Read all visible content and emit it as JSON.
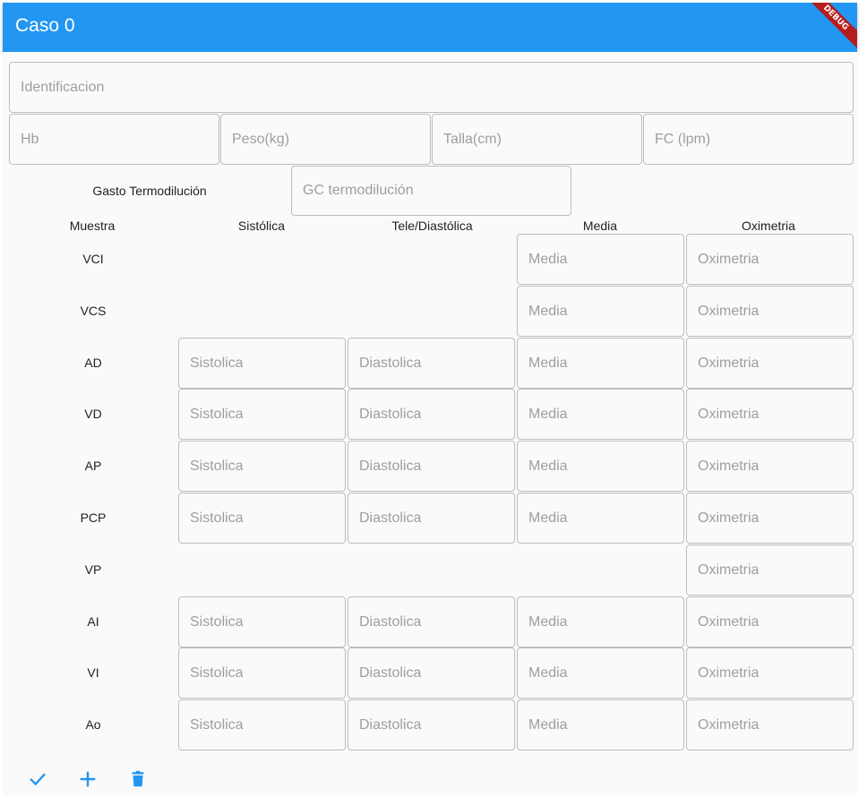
{
  "appbar": {
    "title": "Caso 0",
    "debug_label": "DEBUG"
  },
  "patient": {
    "identificacion_placeholder": "Identificacion",
    "hb_placeholder": "Hb",
    "peso_placeholder": "Peso(kg)",
    "talla_placeholder": "Talla(cm)",
    "fc_placeholder": "FC (lpm)"
  },
  "gasto": {
    "label": "Gasto Termodilución",
    "placeholder": "GC termodilución"
  },
  "table": {
    "headers": [
      "Muestra",
      "Sistólica",
      "Tele/Diastólica",
      "Media",
      "Oximetria"
    ],
    "sistolica_placeholder": "Sistolica",
    "diastolica_placeholder": "Diastolica",
    "media_placeholder": "Media",
    "oximetria_placeholder": "Oximetria",
    "rows": [
      {
        "label": "VCI",
        "sistolica": false,
        "diastolica": false,
        "media": true,
        "oximetria": true
      },
      {
        "label": "VCS",
        "sistolica": false,
        "diastolica": false,
        "media": true,
        "oximetria": true
      },
      {
        "label": "AD",
        "sistolica": true,
        "diastolica": true,
        "media": true,
        "oximetria": true
      },
      {
        "label": "VD",
        "sistolica": true,
        "diastolica": true,
        "media": true,
        "oximetria": true
      },
      {
        "label": "AP",
        "sistolica": true,
        "diastolica": true,
        "media": true,
        "oximetria": true
      },
      {
        "label": "PCP",
        "sistolica": true,
        "diastolica": true,
        "media": true,
        "oximetria": true
      },
      {
        "label": "VP",
        "sistolica": false,
        "diastolica": false,
        "media": false,
        "oximetria": true
      },
      {
        "label": "AI",
        "sistolica": true,
        "diastolica": true,
        "media": true,
        "oximetria": true
      },
      {
        "label": "VI",
        "sistolica": true,
        "diastolica": true,
        "media": true,
        "oximetria": true
      },
      {
        "label": "Ao",
        "sistolica": true,
        "diastolica": true,
        "media": true,
        "oximetria": true
      }
    ]
  },
  "actions": [
    {
      "icon": "check-icon",
      "name": "save-button"
    },
    {
      "icon": "plus-icon",
      "name": "add-button"
    },
    {
      "icon": "trash-icon",
      "name": "delete-button"
    }
  ],
  "colors": {
    "primary": "#2196f3",
    "debug_banner": "#b71c1c",
    "border": "#bdbdbd",
    "placeholder": "#9e9e9e"
  }
}
